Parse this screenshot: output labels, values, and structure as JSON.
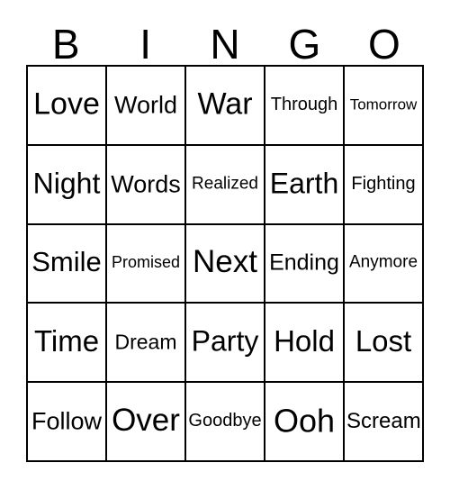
{
  "card": {
    "type": "bingo-card",
    "columns": 5,
    "rows": 5,
    "header_letters": [
      "B",
      "I",
      "N",
      "G",
      "O"
    ],
    "background_color": "#ffffff",
    "text_color": "#000000",
    "border_color": "#000000",
    "grid": [
      [
        {
          "text": "Love",
          "font_size": "34px"
        },
        {
          "text": "World",
          "font_size": "27px"
        },
        {
          "text": "War",
          "font_size": "34px"
        },
        {
          "text": "Through",
          "font_size": "20px"
        },
        {
          "text": "Tomorrow",
          "font_size": "17px"
        }
      ],
      [
        {
          "text": "Night",
          "font_size": "32px"
        },
        {
          "text": "Words",
          "font_size": "27px"
        },
        {
          "text": "Realized",
          "font_size": "19px"
        },
        {
          "text": "Earth",
          "font_size": "32px"
        },
        {
          "text": "Fighting",
          "font_size": "20px"
        }
      ],
      [
        {
          "text": "Smile",
          "font_size": "31px"
        },
        {
          "text": "Promised",
          "font_size": "18px"
        },
        {
          "text": "Next",
          "font_size": "35px"
        },
        {
          "text": "Ending",
          "font_size": "25px"
        },
        {
          "text": "Anymore",
          "font_size": "19px"
        }
      ],
      [
        {
          "text": "Time",
          "font_size": "33px"
        },
        {
          "text": "Dream",
          "font_size": "23px"
        },
        {
          "text": "Party",
          "font_size": "32px"
        },
        {
          "text": "Hold",
          "font_size": "33px"
        },
        {
          "text": "Lost",
          "font_size": "33px"
        }
      ],
      [
        {
          "text": "Follow",
          "font_size": "27px"
        },
        {
          "text": "Over",
          "font_size": "35px"
        },
        {
          "text": "Goodbye",
          "font_size": "20px"
        },
        {
          "text": "Ooh",
          "font_size": "36px"
        },
        {
          "text": "Scream",
          "font_size": "24px"
        }
      ]
    ]
  }
}
